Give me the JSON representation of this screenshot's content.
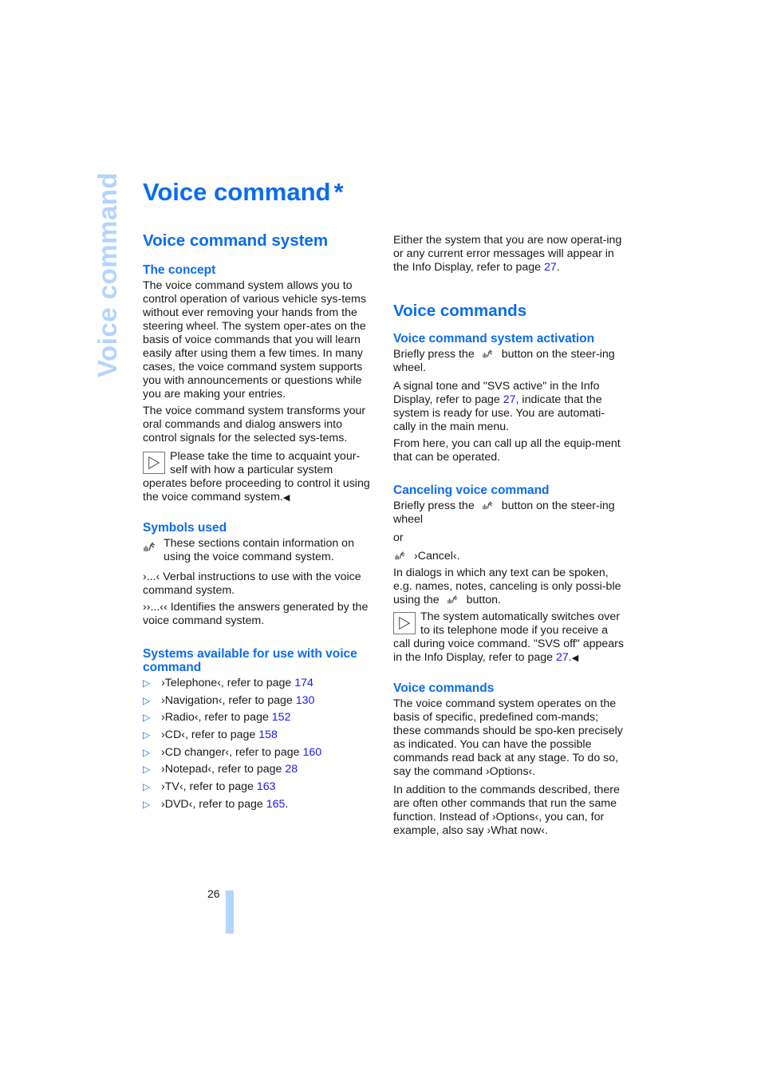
{
  "side_tab": "Voice command",
  "title": "Voice command",
  "title_marker": "*",
  "left": {
    "heading": "Voice command system",
    "concept": {
      "heading": "The concept",
      "paragraphs": [
        "The voice command system allows you to control operation of various vehicle sys-tems without ever removing your hands from the steering wheel. The system oper-ates on the basis of voice commands that you will learn easily after using them a few times. In many cases, the voice command system supports you with announcements or questions while you are making your entries.",
        "The voice command system transforms your oral commands and dialog answers into control signals for the selected sys-tems."
      ],
      "note": "Please take the time to acquaint your-self with how a particular system operates before proceeding to control it using the voice command system.",
      "end_mark": "◀"
    },
    "symbols": {
      "heading": "Symbols used",
      "items": [
        {
          "icon": "voice-command-icon",
          "text": "These sections contain information on using the voice command system."
        },
        {
          "symbol": "›...‹",
          "text": "Verbal instructions to use with the voice command system."
        },
        {
          "symbol": "››...‹‹",
          "text": "Identifies the answers generated by the voice command system."
        }
      ]
    },
    "systems": {
      "heading": "Systems available for use with voice command",
      "bullet": "▷",
      "items": [
        {
          "label": "›Telephone‹, refer to page ",
          "page": "174",
          "suffix": ""
        },
        {
          "label": "›Navigation‹, refer to page ",
          "page": "130",
          "suffix": ""
        },
        {
          "label": "›Radio‹, refer to page ",
          "page": "152",
          "suffix": ""
        },
        {
          "label": "›CD‹, refer to page ",
          "page": "158",
          "suffix": ""
        },
        {
          "label": "›CD changer‹, refer to page ",
          "page": "160",
          "suffix": ""
        },
        {
          "label": "›Notepad‹, refer to page ",
          "page": "28",
          "suffix": ""
        },
        {
          "label": "›TV‹, refer to page ",
          "page": "163",
          "suffix": ""
        },
        {
          "label": "›DVD‹, refer to page ",
          "page": "165",
          "suffix": "."
        }
      ]
    }
  },
  "right": {
    "intro": {
      "text": "Either the system that you are now operat-ing or any current error messages will appear in the Info Display, refer to page ",
      "page": "27",
      "suffix": "."
    },
    "heading": "Voice commands",
    "activation": {
      "heading": "Voice command system activation",
      "p1_before": "Briefly press the",
      "p1_after": "button on the steer-ing wheel.",
      "p2_before": "A signal tone and \"SVS active\" in the Info Display, refer to page ",
      "p2_page": "27",
      "p2_after": ", indicate that the system is ready for use. You are automati-cally in the main menu.",
      "p3": "From here, you can call up all the equip-ment that can be operated."
    },
    "canceling": {
      "heading": "Canceling voice command",
      "p1_before": "Briefly press the",
      "p1_after": "button on the steer-ing wheel",
      "or": "or",
      "cancel_cmd": "›Cancel‹.",
      "p2_before": "In dialogs in which any text can be spoken, e.g. names, notes, canceling is only possi-ble using the",
      "p2_after": "button.",
      "note_before": "The system automatically switches over to its telephone mode if you receive a call during voice command. \"SVS off\" appears in the Info Display, refer to page ",
      "note_page": "27",
      "note_after": ".",
      "end_mark": "◀"
    },
    "commands": {
      "heading": "Voice commands",
      "p1": "The voice command system operates on the basis of specific, predefined com-mands; these commands should be spo-ken precisely as indicated. You can have the possible commands read back at any stage. To do so, say the command ›Options‹.",
      "p2": "In addition to the commands described, there are often other commands that run the same function. Instead of ›Options‹, you can, for example, also say ›What now‹."
    }
  },
  "footer": {
    "page_number": "26"
  },
  "colors": {
    "accent": "#0a6cf0",
    "side_tab": "#b3d4ff",
    "link": "#1a1ae6"
  }
}
